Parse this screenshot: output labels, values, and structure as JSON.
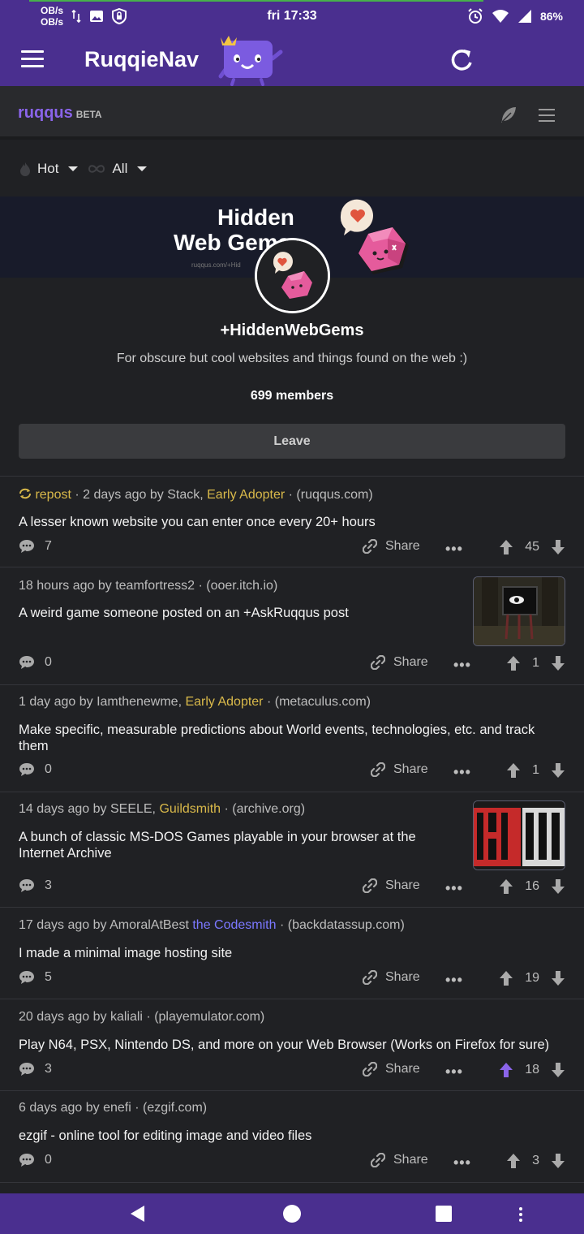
{
  "status_bar": {
    "net_up": "OB/s",
    "net_down": "OB/s",
    "time": "fri 17:33",
    "battery": "86%"
  },
  "app_bar": {
    "title": "RuqqieNav"
  },
  "site_header": {
    "brand": "ruqqus",
    "beta": "BETA"
  },
  "sort": {
    "sort_label": "Hot",
    "time_label": "All"
  },
  "guild": {
    "banner_title_line1": "Hidden",
    "banner_title_line2": "Web Gems",
    "banner_url": "ruqqus.com/+Hid",
    "name": "+HiddenWebGems",
    "description": "For obscure but cool websites and things found on the web :)",
    "members": "699 members",
    "leave_label": "Leave"
  },
  "posts": [
    {
      "repost_label": "repost",
      "meta_prefix": " · 2 days ago by Stack, ",
      "badge": "Early Adopter",
      "domain": " · (ruqqus.com)",
      "title": "A lesser known website you can enter once every 20+ hours",
      "comments": "7",
      "share": "Share",
      "votes": "45"
    },
    {
      "meta_prefix": "18 hours ago by teamfortress2",
      "badge": "",
      "domain": " · (ooer.itch.io)",
      "title": "A weird game someone posted on an +AskRuqqus post",
      "comments": "0",
      "share": "Share",
      "votes": "1"
    },
    {
      "meta_prefix": "1 day ago by Iamthenewme, ",
      "badge": "Early Adopter",
      "domain": " · (metaculus.com)",
      "title": "Make specific, measurable predictions about World events, technologies, etc. and track them",
      "comments": "0",
      "share": "Share",
      "votes": "1"
    },
    {
      "meta_prefix": "14 days ago by SEELE, ",
      "badge": "Guildsmith",
      "domain": " · (archive.org)",
      "title": "A bunch of classic MS-DOS Games playable in your browser at the Internet Archive",
      "comments": "3",
      "share": "Share",
      "votes": "16"
    },
    {
      "meta_prefix": "17 days ago by AmoralAtBest ",
      "badge": "the Codesmith",
      "domain": " · (backdatassup.com)",
      "title": "I made a minimal image hosting site",
      "comments": "5",
      "share": "Share",
      "votes": "19"
    },
    {
      "meta_prefix": "20 days ago by kaliali",
      "badge": "",
      "domain": " · (playemulator.com)",
      "title": "Play N64, PSX, Nintendo DS, and more on your Web Browser (Works on Firefox for sure)",
      "comments": "3",
      "share": "Share",
      "votes": "18"
    },
    {
      "meta_prefix": "6 days ago by enefi",
      "badge": "",
      "domain": " · (ezgif.com)",
      "title": "ezgif - online tool for editing image and video files",
      "comments": "0",
      "share": "Share",
      "votes": "3"
    }
  ],
  "colors": {
    "primary": "#4a2f8f",
    "accent": "#8a64ea",
    "badge_yellow": "#d9b94a",
    "badge_blue": "#7b78ff",
    "background": "#202124"
  }
}
